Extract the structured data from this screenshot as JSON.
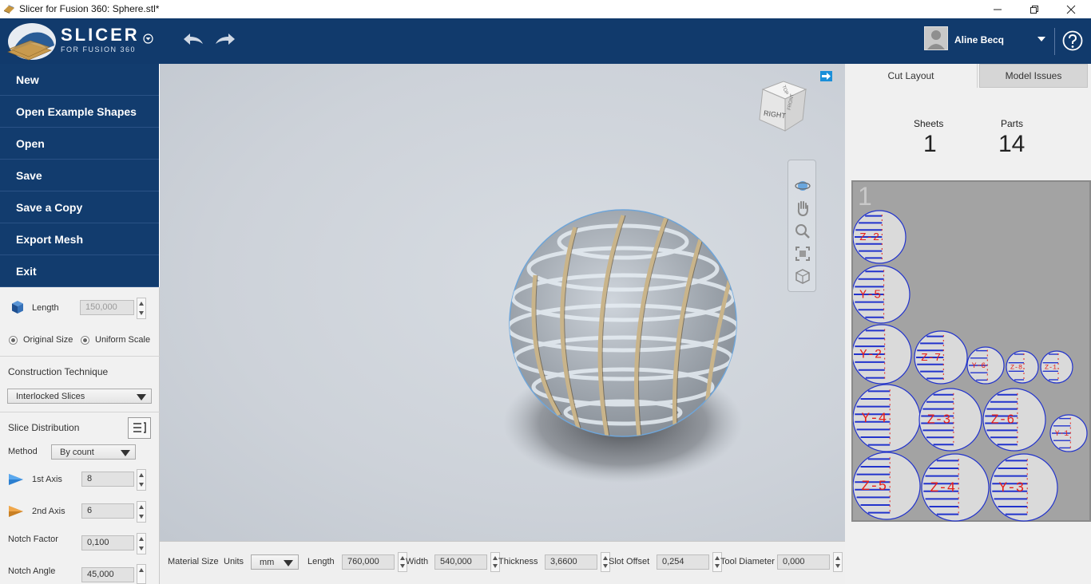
{
  "window": {
    "title": "Slicer for Fusion 360: Sphere.stl*"
  },
  "header": {
    "brand": "SLICER",
    "brand_sub": "FOR FUSION 360",
    "user_name": "Aline Becq"
  },
  "menu": {
    "items": [
      "New",
      "Open Example Shapes",
      "Open",
      "Save",
      "Save a Copy",
      "Export Mesh",
      "Exit"
    ]
  },
  "left_panel": {
    "length_label": "Length",
    "length_value": "150,000",
    "original_size": "Original Size",
    "uniform_scale": "Uniform Scale",
    "construction_title": "Construction Technique",
    "construction_value": "Interlocked Slices",
    "slice_title": "Slice Distribution",
    "method_label": "Method",
    "method_value": "By count",
    "axis1_label": "1st Axis",
    "axis1_value": "8",
    "axis2_label": "2nd Axis",
    "axis2_value": "6",
    "notch_factor_label": "Notch Factor",
    "notch_factor_value": "0,100",
    "notch_angle_label": "Notch Angle",
    "notch_angle_value": "45,000"
  },
  "viewcube": {
    "face": "RIGHT",
    "top": "TOP",
    "front": "FRONT"
  },
  "bottom_bar": {
    "material_size": "Material Size",
    "units_label": "Units",
    "units_value": "mm",
    "length_label": "Length",
    "length_value": "760,000",
    "width_label": "Width",
    "width_value": "540,000",
    "thickness_label": "Thickness",
    "thickness_value": "3,6600",
    "slot_offset_label": "Slot Offset",
    "slot_offset_value": "0,254",
    "tool_diameter_label": "Tool Diameter",
    "tool_diameter_value": "0,000"
  },
  "right_panel": {
    "tabs": [
      "Cut Layout",
      "Model Issues"
    ],
    "sheets_label": "Sheets",
    "sheets_value": "1",
    "parts_label": "Parts",
    "parts_value": "14",
    "sheet_number": "1",
    "part_labels": [
      "Z-2",
      "Y-5",
      "Y-2",
      "Z-7",
      "Y-6",
      "Z-8",
      "Z-1",
      "Y-4",
      "Z-3",
      "Z-6",
      "Y-1",
      "Z-5",
      "Z-4",
      "Y-3"
    ]
  },
  "colors": {
    "header": "#113a6c",
    "menu": "#123c6e",
    "part_outline": "#2233cc",
    "part_label": "#e8201a",
    "accent": "#1a8fd9"
  }
}
